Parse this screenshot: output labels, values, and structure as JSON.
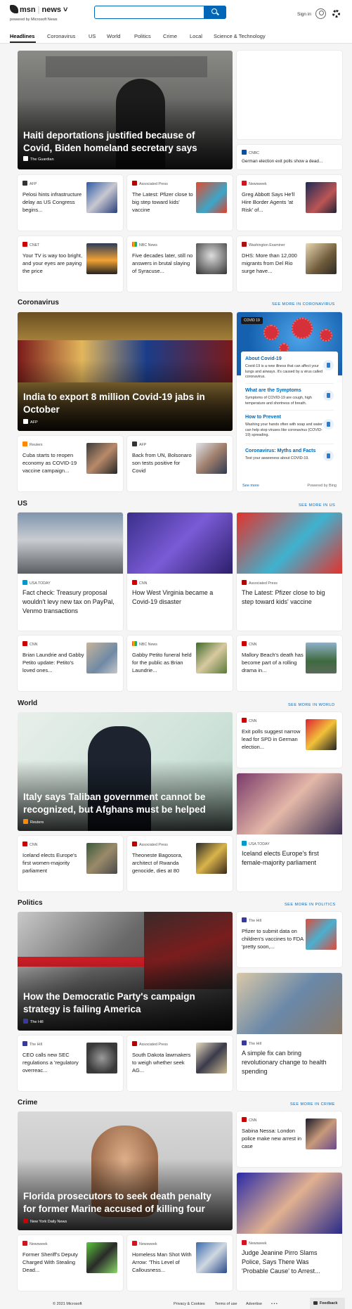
{
  "header": {
    "logo": "msn",
    "vertical": "news",
    "powered": "powered by Microsoft News",
    "search_placeholder": "",
    "signin": "Sign in"
  },
  "nav": [
    "Headlines",
    "Coronavirus",
    "US",
    "World",
    "Politics",
    "Crime",
    "Local",
    "Science & Technology"
  ],
  "top": {
    "hero": {
      "title": "Haiti deportations justified because of Covid, Biden homeland secretary says",
      "source": "The Guardian"
    },
    "side": {
      "source": "CNBC",
      "title": "German election exit polls show a dead..."
    },
    "cards": [
      {
        "source": "AFP",
        "title": "Pelosi hints infrastructure delay as US Congress begins..."
      },
      {
        "source": "Associated Press",
        "title": "The Latest: Pfizer close to big step toward kids' vaccine"
      },
      {
        "source": "Newsweek",
        "title": "Greg Abbott Says He'll Hire Border Agents 'at Risk' of..."
      },
      {
        "source": "CNET",
        "title": "Your TV is way too bright, and your eyes are paying the price"
      },
      {
        "source": "NBC News",
        "title": "Five decades later, still no answers in brutal slaying of Syracuse..."
      },
      {
        "source": "Washington Examiner",
        "title": "DHS: More than 12,000 migrants from Del Rio surge have..."
      }
    ]
  },
  "coronavirus": {
    "heading": "Coronavirus",
    "see_more": "SEE MORE IN CORONAVIRUS",
    "hero": {
      "title": "India to export 8 million Covid-19 jabs in October",
      "source": "AFP"
    },
    "cards": [
      {
        "source": "Reuters",
        "title": "Cuba starts to reopen economy as COVID-19 vaccine campaign..."
      },
      {
        "source": "AFP",
        "title": "Back from UN, Bolsonaro son tests positive for Covid"
      }
    ],
    "panel": {
      "badge": "COVID 19",
      "items": [
        {
          "title": "About Covid-19",
          "desc": "Covid-19 is a new illness that can affect your lungs and airways. It's caused by a virus called coronavirus."
        },
        {
          "title": "What are the Symptoms",
          "desc": "Symptoms of COVID-19 are cough, high temperature and shortness of breath."
        },
        {
          "title": "How to Prevent",
          "desc": "Washing your hands often with soap and water can help stop viruses like coronavirus (COVID-19) spreading."
        },
        {
          "title": "Coronavirus: Myths and Facts",
          "desc": "Test your awareness about COVID-19."
        }
      ],
      "see_more": "See more",
      "powered": "Powered by Bing"
    }
  },
  "us": {
    "heading": "US",
    "see_more": "SEE MORE IN US",
    "big": [
      {
        "source": "USA TODAY",
        "title": "Fact check: Treasury proposal wouldn't levy new tax on PayPal, Venmo transactions"
      },
      {
        "source": "CNN",
        "title": "How West Virginia became a Covid-19 disaster"
      },
      {
        "source": "Associated Press",
        "title": "The Latest: Pfizer close to big step toward kids' vaccine"
      }
    ],
    "cards": [
      {
        "source": "CNN",
        "title": "Brian Laundrie and Gabby Petito update: Petito's loved ones..."
      },
      {
        "source": "NBC News",
        "title": "Gabby Petito funeral held for the public as Brian Laundrie..."
      },
      {
        "source": "CNN",
        "title": "Mallory Beach's death has become part of a rolling drama in..."
      }
    ]
  },
  "world": {
    "heading": "World",
    "see_more": "SEE MORE IN WORLD",
    "hero": {
      "title": "Italy says Taliban government cannot be recognized, but Afghans must be helped",
      "source": "Reuters"
    },
    "side": {
      "source": "CNN",
      "title": "Exit polls suggest narrow lead for SPD in German election..."
    },
    "big": {
      "source": "USA TODAY",
      "title": "Iceland elects Europe's first female-majority parliament"
    },
    "cards": [
      {
        "source": "CNN",
        "title": "Iceland elects Europe's first women-majority parliament"
      },
      {
        "source": "Associated Press",
        "title": "Theoneste Bagosora, architect of Rwanda genocide, dies at 80"
      }
    ]
  },
  "politics": {
    "heading": "Politics",
    "see_more": "SEE MORE IN POLITICS",
    "hero": {
      "title": "How the Democratic Party's campaign strategy is failing America",
      "source": "The Hill"
    },
    "side": {
      "source": "The Hill",
      "title": "Pfizer to submit data on children's vaccines to FDA 'pretty soon,..."
    },
    "big": {
      "source": "The Hill",
      "title": "A simple fix can bring revolutionary change to health spending"
    },
    "cards": [
      {
        "source": "The Hill",
        "title": "CEO calls new SEC regulations a 'regulatory overreac..."
      },
      {
        "source": "Associated Press",
        "title": "South Dakota lawmakers to weigh whether seek AG..."
      }
    ]
  },
  "crime": {
    "heading": "Crime",
    "see_more": "SEE MORE IN CRIME",
    "hero": {
      "title": "Florida prosecutors to seek death penalty for former Marine accused of killing four",
      "source": "New York Daily News"
    },
    "side": {
      "source": "CNN",
      "title": "Sabina Nessa: London police make new arrest in case"
    },
    "big": {
      "source": "Newsweek",
      "title": "Judge Jeanine Pirro Slams Police, Says There Was 'Probable Cause' to Arrest..."
    },
    "cards": [
      {
        "source": "Newsweek",
        "title": "Former Sheriff's Deputy Charged With Stealing Dead..."
      },
      {
        "source": "Newsweek",
        "title": "Homeless Man Shot With Arrow: 'This Level of Callousness..."
      }
    ]
  },
  "footer": {
    "copyright": "© 2021 Microsoft",
    "privacy": "Privacy & Cookies",
    "terms": "Terms of use",
    "advertise": "Advertise",
    "more": "• • •",
    "feedback": "Feedback"
  }
}
